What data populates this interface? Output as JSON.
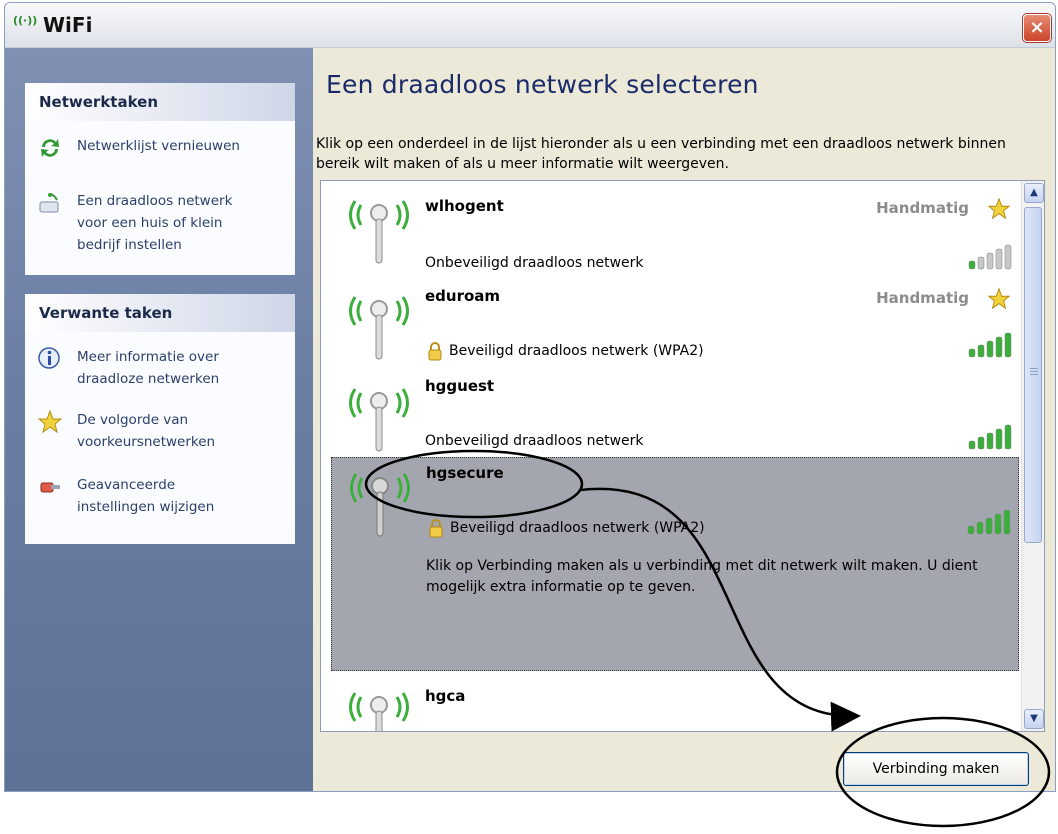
{
  "window": {
    "title": "WiFi",
    "title_icon": "wireless-signal-icon",
    "close_label": "×"
  },
  "sidebar": {
    "network_tasks": {
      "header": "Netwerktaken",
      "items": [
        {
          "icon": "refresh-icon",
          "label": "Netwerklijst vernieuwen"
        },
        {
          "icon": "setup-network-icon",
          "label": "Een draadloos netwerk\nvoor een huis of klein\nbedrijf instellen"
        }
      ]
    },
    "related_tasks": {
      "header": "Verwante taken",
      "items": [
        {
          "icon": "info-icon",
          "label": "Meer informatie over\ndraadloze netwerken"
        },
        {
          "icon": "star-icon",
          "label": "De volgorde van\nvoorkeursnetwerken"
        },
        {
          "icon": "settings-icon",
          "label": "Geavanceerde\ninstellingen wijzigen"
        }
      ]
    }
  },
  "main": {
    "title": "Een draadloos netwerk selecteren",
    "description": "Klik op een onderdeel in de lijst hieronder als u een verbinding met een draadloos netwerk binnen bereik wilt maken of als u meer informatie wilt weergeven."
  },
  "networks": [
    {
      "name": "wlhogent",
      "mode": "Handmatig",
      "preferred": true,
      "security": "Onbeveiligd draadloos netwerk",
      "secured": false,
      "signal_bars": 1
    },
    {
      "name": "eduroam",
      "mode": "Handmatig",
      "preferred": true,
      "security": "Beveiligd draadloos netwerk (WPA2)",
      "secured": true,
      "signal_bars": 5
    },
    {
      "name": "hgguest",
      "mode": "",
      "preferred": false,
      "security": "Onbeveiligd draadloos netwerk",
      "secured": false,
      "signal_bars": 5
    },
    {
      "name": "hgsecure",
      "mode": "",
      "preferred": false,
      "security": "Beveiligd draadloos netwerk (WPA2)",
      "secured": true,
      "signal_bars": 5,
      "selected": true,
      "info": "Klik op Verbinding maken als u verbinding met dit netwerk wilt maken. U dient mogelijk extra informatie op te geven."
    },
    {
      "name": "hgca",
      "mode": "",
      "preferred": false,
      "security": "",
      "secured": false,
      "signal_bars": 0
    }
  ],
  "connect_button": {
    "label": "Verbinding maken"
  },
  "colors": {
    "signal_on": "#3cae3c",
    "signal_off": "#c8c8c8",
    "annotation": "#000000"
  }
}
